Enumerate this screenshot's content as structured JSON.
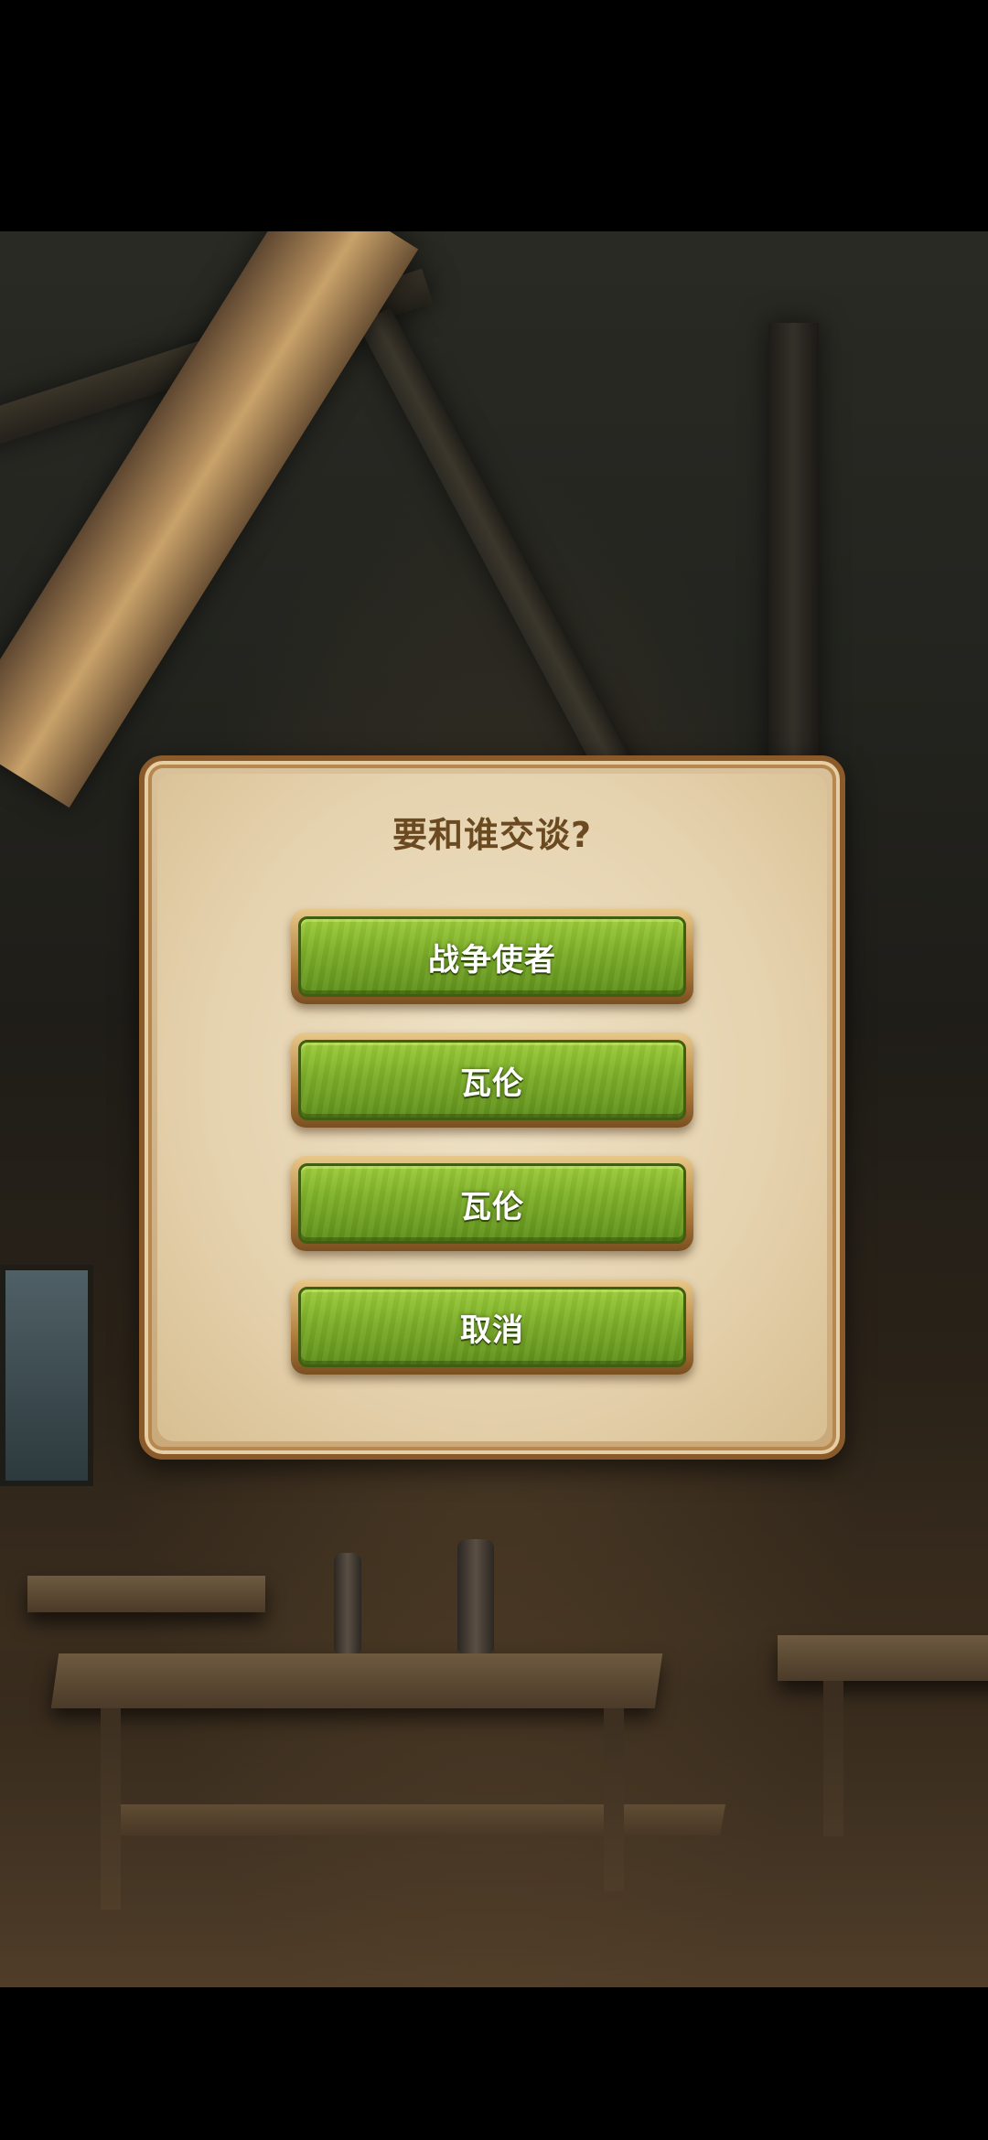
{
  "dialog": {
    "title": "要和谁交谈?",
    "options": [
      {
        "label": "战争使者"
      },
      {
        "label": "瓦伦"
      },
      {
        "label": "瓦伦"
      },
      {
        "label": "取消"
      }
    ]
  },
  "colors": {
    "panel": "#e5d2ae",
    "panel_border": "#8a5a2a",
    "button_green": "#7fb12a",
    "title_text": "#6b4a22"
  }
}
